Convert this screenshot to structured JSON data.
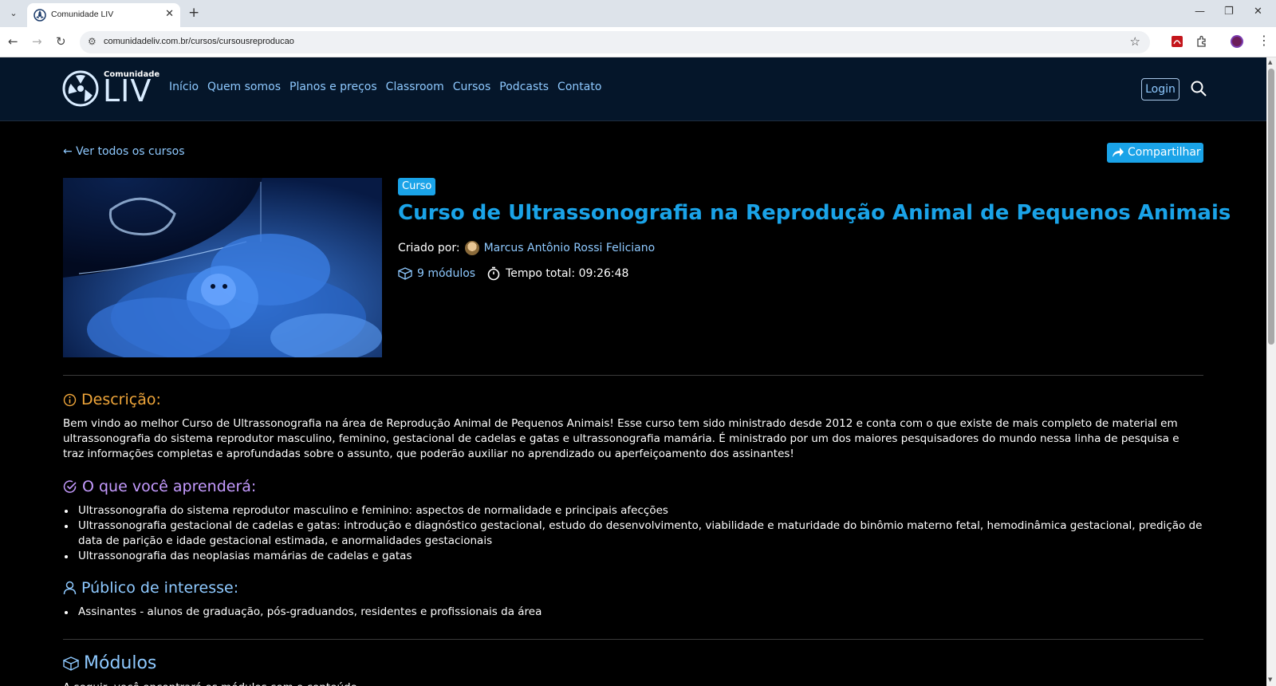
{
  "browser": {
    "tab_title": "Comunidade LIV",
    "url": "comunidadeliv.com.br/cursos/cursousreproducao"
  },
  "site": {
    "logo_small": "Comunidade",
    "logo_big": "LIV",
    "nav": [
      "Início",
      "Quem somos",
      "Planos e preços",
      "Classroom",
      "Cursos",
      "Podcasts",
      "Contato"
    ],
    "login_label": "Login"
  },
  "course": {
    "back_link": "← Ver todos os cursos",
    "share_label": "Compartilhar",
    "badge": "Curso",
    "title": "Curso de Ultrassonografia na Reprodução Animal de Pequenos Animais",
    "created_by_label": "Criado por:",
    "author": "Marcus Antônio Rossi Feliciano",
    "modules_count": "9 módulos",
    "total_time": "Tempo total: 09:26:48"
  },
  "description": {
    "heading": "Descrição:",
    "text": "Bem vindo ao melhor Curso de Ultrassonografia na área de Reprodução Animal de Pequenos Animais! Esse curso tem sido ministrado desde 2012 e conta com o que existe de mais completo de material em ultrassonografia do sistema reprodutor masculino, feminino, gestacional de cadelas e gatas e ultrassonografia mamária. É ministrado por um dos maiores pesquisadores do mundo nessa linha de pesquisa e traz informações completas e aprofundadas sobre o assunto, que poderão auxiliar no aprendizado ou aperfeiçoamento dos assinantes!"
  },
  "learn": {
    "heading": "O que você aprenderá:",
    "items": [
      "Ultrassonografia do sistema reprodutor masculino e feminino: aspectos de normalidade e principais afecções",
      "Ultrassonografia gestacional de cadelas e gatas: introdução e diagnóstico gestacional, estudo do desenvolvimento, viabilidade e maturidade do binômio materno fetal, hemodinâmica gestacional, predição de data de parição e idade gestacional estimada, e anormalidades gestacionais",
      "Ultrassonografia das neoplasias mamárias de cadelas e gatas"
    ]
  },
  "audience": {
    "heading": "Público de interesse:",
    "items": [
      "Assinantes - alunos de graduação, pós-graduandos, residentes e profissionais da área"
    ]
  },
  "modules_section": {
    "heading": "Módulos",
    "partial_text": "A seguir, você encontrará os módulos com o conteúdo"
  },
  "colors": {
    "accent": "#1aa3e8",
    "nav_link": "#8ec9ff",
    "description_heading": "#f0a63a",
    "learn_heading": "#c59bff",
    "header_bg": "#05162a"
  }
}
